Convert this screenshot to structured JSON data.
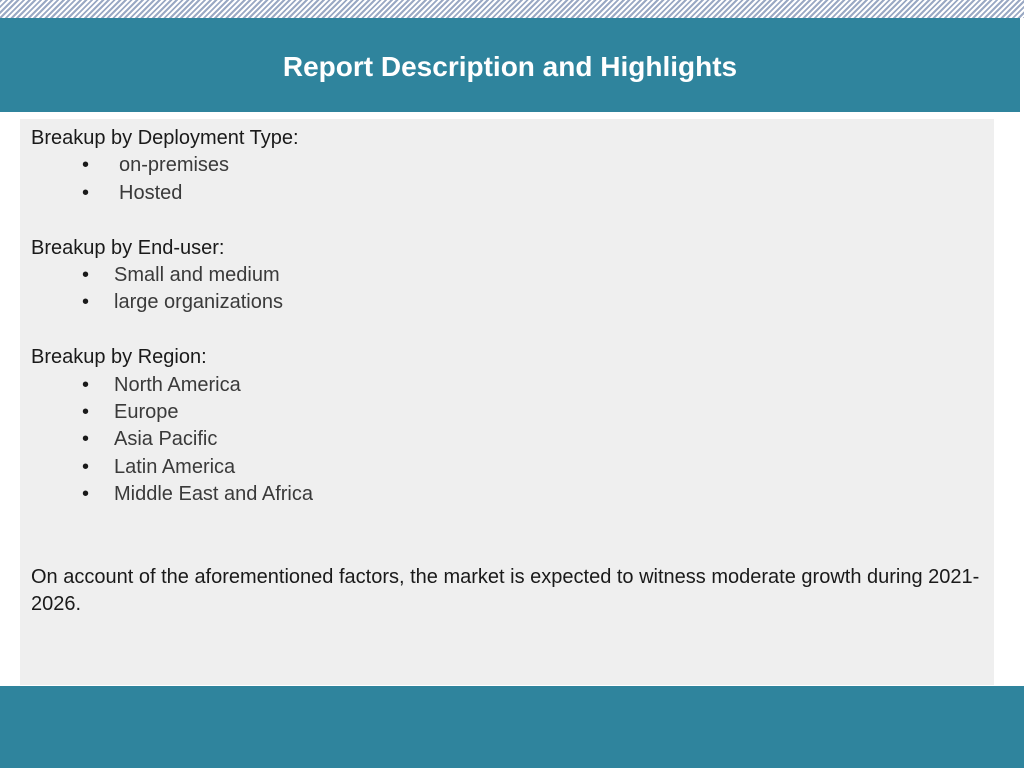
{
  "header": {
    "title": "Report Description and Highlights"
  },
  "sections": [
    {
      "heading": "Breakup by Deployment Type:",
      "items": [
        "on-premises",
        "Hosted"
      ]
    },
    {
      "heading": "Breakup by End-user:",
      "items": [
        "Small and medium",
        "large organizations"
      ]
    },
    {
      "heading": "Breakup by Region:",
      "items": [
        "North America",
        "Europe",
        "Asia Pacific",
        "Latin America",
        "Middle East and Africa"
      ]
    }
  ],
  "summary": "On account of the aforementioned factors, the market is expected to witness moderate growth during 2021-2026.",
  "bullet_glyph": "•",
  "colors": {
    "band": "#2f849d",
    "panel": "#efefef",
    "title": "#ffffff"
  }
}
